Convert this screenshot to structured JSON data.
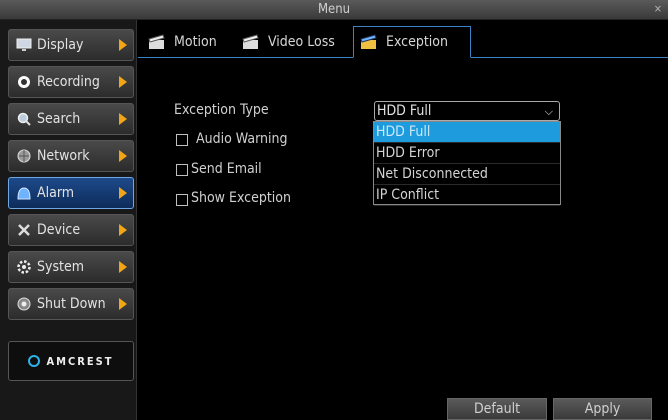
{
  "window": {
    "title": "Menu",
    "close_label": "×"
  },
  "sidebar": {
    "items": [
      {
        "label": "Display",
        "icon": "monitor-icon"
      },
      {
        "label": "Recording",
        "icon": "record-icon"
      },
      {
        "label": "Search",
        "icon": "search-icon"
      },
      {
        "label": "Network",
        "icon": "globe-icon"
      },
      {
        "label": "Alarm",
        "icon": "alarm-icon",
        "active": true
      },
      {
        "label": "Device",
        "icon": "tools-icon"
      },
      {
        "label": "System",
        "icon": "gear-icon"
      },
      {
        "label": "Shut Down",
        "icon": "power-icon"
      }
    ],
    "logo_text": "AMCREST"
  },
  "tabs": [
    {
      "label": "Motion",
      "icon": "clapperboard-icon"
    },
    {
      "label": "Video Loss",
      "icon": "clapperboard-icon"
    },
    {
      "label": "Exception",
      "icon": "clapperboard-icon",
      "active": true
    }
  ],
  "form": {
    "exception_type_label": "Exception Type",
    "exception_type_value": "HDD Full",
    "exception_type_options": [
      "HDD Full",
      "HDD Error",
      "Net Disconnected",
      "IP Conflict"
    ],
    "audio_warning_label": "Audio Warning",
    "audio_warning_checked": false,
    "send_email_label": "Send Email",
    "send_email_checked": false,
    "show_exception_label": "Show Exception",
    "show_exception_checked": false
  },
  "buttons": {
    "default_label": "Default",
    "apply_label": "Apply"
  },
  "colors": {
    "accent_blue": "#3b83c5",
    "selection_blue": "#1d9bdc",
    "arrow_orange": "#f2a516",
    "background": "#000000"
  }
}
